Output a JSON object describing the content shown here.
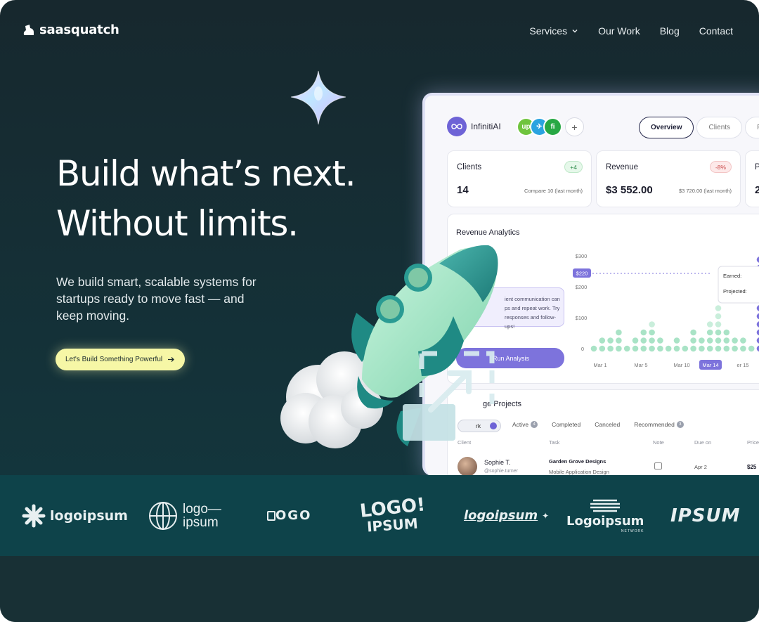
{
  "brand": {
    "name": "saasquatch"
  },
  "nav": {
    "services": "Services",
    "our_work": "Our Work",
    "blog": "Blog",
    "contact": "Contact"
  },
  "hero": {
    "line1": "Build what’s next.",
    "line2": "Without limits.",
    "subtitle": "We build smart, scalable systems for startups ready to move fast — and keep moving.",
    "cta": "Let's Build Something Powerful"
  },
  "dashboard": {
    "app_name": "InfinitiAI",
    "avatars": [
      "up",
      "✈",
      "fi"
    ],
    "tabs": [
      "Overview",
      "Clients",
      "Pr"
    ],
    "cards": [
      {
        "title": "Clients",
        "value": "14",
        "badge": "+4",
        "compare": "Compare 10 (last month)"
      },
      {
        "title": "Revenue",
        "value": "$3 552.00",
        "badge": "-8%",
        "compare": "$3 720.00 (last month)"
      },
      {
        "title": "P",
        "value": "2",
        "badge": "",
        "compare": ""
      }
    ],
    "analytics": {
      "title": "Revenue Analytics",
      "ai_label_fragment": "d",
      "ai_text": [
        "ient communication can",
        "ps and repeat work. Try",
        "responses and follow-ups!"
      ],
      "run_button": "Run Analysis",
      "y_ticks": [
        "$300",
        "$200",
        "$100",
        "0"
      ],
      "x_ticks": [
        "Mar 1",
        "Mar 5",
        "Mar 10",
        "Mar 14",
        "er 15"
      ],
      "value_tag": "$220",
      "tooltip": [
        "Earned:",
        "Projected:"
      ]
    },
    "manage": {
      "title": "ge Projects",
      "tabs": [
        {
          "label": "Active",
          "count": "4"
        },
        {
          "label": "Completed",
          "count": ""
        },
        {
          "label": "Canceled",
          "count": ""
        },
        {
          "label": "Recommended",
          "count": "3"
        }
      ],
      "selected_tab_fragment": "rk",
      "columns": [
        "Client",
        "Task",
        "Note",
        "Due on",
        "Price"
      ],
      "row": {
        "name": "Sophie T.",
        "handle": "@sophie.turner",
        "project": "Garden Grove Designs",
        "task": "Mobile Application Design",
        "due": "Apr 2",
        "price": "$25"
      }
    }
  },
  "logos": [
    {
      "name": "logoipsum",
      "text": "logoipsum"
    },
    {
      "name": "logo-ipsum",
      "text1": "logo—",
      "text2": "ipsum"
    },
    {
      "name": "logo-box",
      "text": "OGO"
    },
    {
      "name": "logo-bubble",
      "text1": "LOGO!",
      "text2": "IPSUM"
    },
    {
      "name": "logoipsum-italic",
      "text": "logoipsum"
    },
    {
      "name": "logoipsum-network",
      "text": "Logoipsum",
      "sub": "NETWORK"
    },
    {
      "name": "ipsum",
      "text": "IPSUM"
    }
  ],
  "colors": {
    "bg": "#17282e",
    "strip": "#0e434a",
    "cta": "#f6f7a6",
    "accent": "#6e63d6",
    "mint": "#a9e8c8"
  }
}
